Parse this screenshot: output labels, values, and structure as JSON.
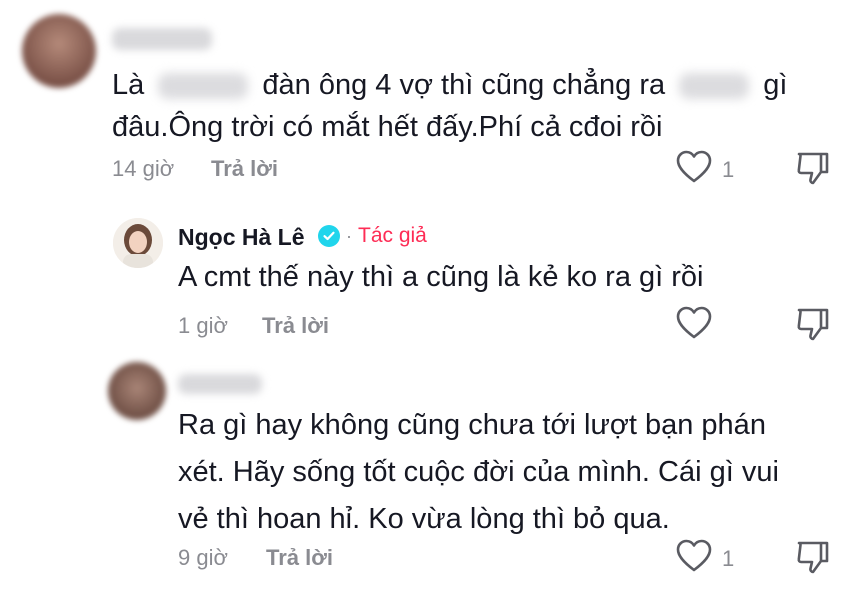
{
  "comments": [
    {
      "text_line1_parts": [
        "Là",
        "đàn ông 4 vợ thì cũng chẳng ra",
        "gì"
      ],
      "text_line2": "đâu.Ông trời có mắt hết đấy.Phí cả cđoi rồi",
      "time": "14 giờ",
      "reply_label": "Trả lời",
      "likes": "1"
    },
    {
      "username": "Ngọc Hà Lê",
      "separator": "·",
      "author_tag": "Tác giả",
      "text": "A cmt thế này thì a cũng là kẻ ko ra gì rồi",
      "time": "1 giờ",
      "reply_label": "Trả lời"
    },
    {
      "text_lines": [
        "Ra gì hay không cũng chưa tới lượt bạn phán",
        "xét. Hãy sống tốt cuộc đời của mình. Cái gì vui",
        "vẻ thì hoan hỉ. Ko vừa lòng thì bỏ qua."
      ],
      "time": "9 giờ",
      "reply_label": "Trả lời",
      "likes": "1"
    }
  ],
  "colors": {
    "text": "#161823",
    "muted": "#8a8b91",
    "author_tag": "#fe2c55",
    "verified": "#20d5ec"
  },
  "icons": {
    "like": "heart-outline-icon",
    "dislike": "thumbs-down-outline-icon",
    "verified": "verified-badge-icon"
  }
}
